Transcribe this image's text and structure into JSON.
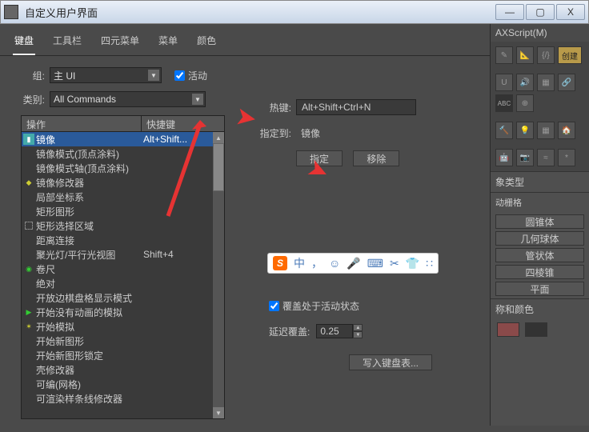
{
  "window": {
    "title": "自定义用户界面",
    "min": "—",
    "max": "▢",
    "close": "X"
  },
  "menubar": {
    "script": "AXScript(M)"
  },
  "tabs": [
    "键盘",
    "工具栏",
    "四元菜单",
    "菜单",
    "颜色"
  ],
  "active_tab": 0,
  "group": {
    "label": "组:",
    "value": "主 UI"
  },
  "active_chk": {
    "label": "活动",
    "checked": true
  },
  "category": {
    "label": "类别:",
    "value": "All Commands"
  },
  "list": {
    "col1": "操作",
    "col2": "快捷键",
    "rows": [
      {
        "icon": "mirror",
        "label": "镜像",
        "shortcut": "Alt+Shift...",
        "sel": true
      },
      {
        "icon": "",
        "label": "镜像模式(顶点涂料)",
        "shortcut": ""
      },
      {
        "icon": "",
        "label": "镜像模式轴(顶点涂料)",
        "shortcut": ""
      },
      {
        "icon": "mod",
        "label": "镜像修改器",
        "shortcut": ""
      },
      {
        "icon": "",
        "label": "局部坐标系",
        "shortcut": ""
      },
      {
        "icon": "",
        "label": "矩形图形",
        "shortcut": ""
      },
      {
        "icon": "rect",
        "label": "矩形选择区域",
        "shortcut": ""
      },
      {
        "icon": "",
        "label": "距离连接",
        "shortcut": ""
      },
      {
        "icon": "",
        "label": "聚光灯/平行光视图",
        "shortcut": "Shift+4"
      },
      {
        "icon": "tape",
        "label": "卷尺",
        "shortcut": ""
      },
      {
        "icon": "",
        "label": "绝对",
        "shortcut": ""
      },
      {
        "icon": "",
        "label": "开放边棋盘格显示模式",
        "shortcut": ""
      },
      {
        "icon": "sim1",
        "label": "开始没有动画的模拟",
        "shortcut": ""
      },
      {
        "icon": "sim2",
        "label": "开始模拟",
        "shortcut": ""
      },
      {
        "icon": "",
        "label": "开始新图形",
        "shortcut": ""
      },
      {
        "icon": "",
        "label": "开始新图形锁定",
        "shortcut": ""
      },
      {
        "icon": "",
        "label": "壳修改器",
        "shortcut": ""
      },
      {
        "icon": "",
        "label": "可编(网格)",
        "shortcut": ""
      },
      {
        "icon": "",
        "label": "可渲染样条线修改器",
        "shortcut": ""
      }
    ]
  },
  "hotkey": {
    "label": "热键:",
    "value": "Alt+Shift+Ctrl+N"
  },
  "assigned": {
    "label": "指定到:",
    "value": "镜像"
  },
  "assign_btn": "指定",
  "remove_btn": "移除",
  "override": {
    "label": "覆盖处于活动状态",
    "checked": true
  },
  "delay": {
    "label": "延迟覆盖:",
    "value": "0.25"
  },
  "write_btn": "写入键盘表...",
  "ime": {
    "zhong": "中",
    "icons": [
      "，",
      "☺",
      "🎤",
      "⌨",
      "✂",
      "👕",
      "∷"
    ]
  },
  "rpanel": {
    "toolbar_icons": [
      "✎",
      "📐",
      "{/}",
      "创建",
      "U",
      "🔊",
      "▦",
      "🔗",
      "ABC",
      "⊕",
      "🔨",
      "💡",
      "▦",
      "🏠",
      "🤖",
      "📷",
      "≈",
      "*"
    ],
    "obj_type": "象类型",
    "grid": "动栅格",
    "shapes": [
      "圆锥体",
      "几何球体",
      "管状体",
      "四棱锥",
      "平面"
    ],
    "color_section": "称和颜色"
  }
}
